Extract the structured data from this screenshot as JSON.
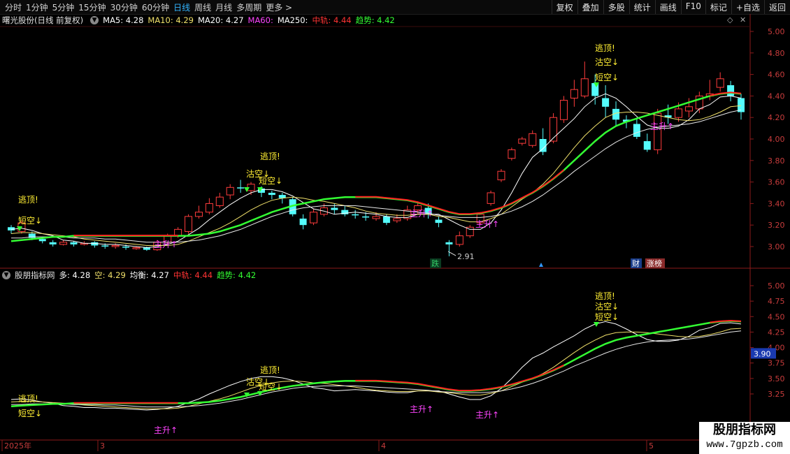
{
  "toolbar": {
    "periods": [
      "分时",
      "1分钟",
      "5分钟",
      "15分钟",
      "30分钟",
      "60分钟",
      "日线",
      "周线",
      "月线",
      "多周期",
      "更多 >"
    ],
    "active_period": "日线",
    "tools": [
      "复权",
      "叠加",
      "多股",
      "统计",
      "画线",
      "F10",
      "标记",
      "+自选",
      "返回"
    ]
  },
  "main_panel": {
    "title": "曙光股份(日线 前复权)",
    "legend": [
      {
        "label": "MA5: 4.28",
        "color": "#ffffff"
      },
      {
        "label": "MA10: 4.29",
        "color": "#f0e06a"
      },
      {
        "label": "MA20: 4.27",
        "color": "#ffffff"
      },
      {
        "label": "MA60:",
        "color": "#ff44ff"
      },
      {
        "label": "MA250:",
        "color": "#ffffff"
      },
      {
        "label": "中轨: 4.44",
        "color": "#ff3333"
      },
      {
        "label": "趋势: 4.42",
        "color": "#33ff33"
      }
    ],
    "y_ticks": [
      "5.00",
      "4.80",
      "4.60",
      "4.40",
      "4.20",
      "4.00",
      "3.80",
      "3.60",
      "3.40",
      "3.20",
      "3.00"
    ],
    "low_label": "2.91",
    "badges": [
      {
        "text": "跌",
        "color": "#33cc66",
        "bg": "#0b3b20"
      },
      {
        "text": "财",
        "color": "#ffffff",
        "bg": "#1a3d8a"
      },
      {
        "text": "涨榜",
        "color": "#ffffff",
        "bg": "#8a2a2a"
      }
    ],
    "annotations": [
      {
        "text": "逃顶!",
        "color": "#ffee33"
      },
      {
        "text": "短空↓",
        "color": "#ffee33"
      },
      {
        "text": "逃顶!",
        "color": "#ffee33"
      },
      {
        "text": "沽空↓",
        "color": "#ffee33"
      },
      {
        "text": "短空↓",
        "color": "#ffee33"
      },
      {
        "text": "逃顶!",
        "color": "#ffee33"
      },
      {
        "text": "沽空↓",
        "color": "#ffee33"
      },
      {
        "text": "短空↓",
        "color": "#ffee33"
      },
      {
        "text": "主升↑",
        "color": "#ff44ff"
      },
      {
        "text": "主升↑",
        "color": "#ff44ff"
      },
      {
        "text": "主升↑",
        "color": "#ff44ff"
      },
      {
        "text": "主升↑",
        "color": "#ff44ff"
      }
    ]
  },
  "sub_panel": {
    "title": "股朋指标网",
    "legend": [
      {
        "label": "多: 4.28",
        "color": "#ffffff"
      },
      {
        "label": "空: 4.29",
        "color": "#f0e06a"
      },
      {
        "label": "均衡: 4.27",
        "color": "#ffffff"
      },
      {
        "label": "中轨: 4.44",
        "color": "#ff3333"
      },
      {
        "label": "趋势: 4.42",
        "color": "#33ff33"
      }
    ],
    "y_ticks": [
      "5.00",
      "4.75",
      "4.50",
      "4.25",
      "4.00",
      "3.75",
      "3.50",
      "3.25"
    ],
    "cursor_value": "3.90",
    "annotations": [
      {
        "text": "逃顶!",
        "color": "#ffee33"
      },
      {
        "text": "短空↓",
        "color": "#ffee33"
      },
      {
        "text": "逃顶!",
        "color": "#ffee33"
      },
      {
        "text": "沽空↓",
        "color": "#ffee33"
      },
      {
        "text": "短空↓",
        "color": "#ffee33"
      },
      {
        "text": "逃顶!",
        "color": "#ffee33"
      },
      {
        "text": "沽空↓",
        "color": "#ffee33"
      },
      {
        "text": "短空↓",
        "color": "#ffee33"
      },
      {
        "text": "主升↑",
        "color": "#ff44ff"
      },
      {
        "text": "主升↑",
        "color": "#ff44ff"
      },
      {
        "text": "主升↑",
        "color": "#ff44ff"
      }
    ]
  },
  "x_axis": [
    "2025年",
    "3",
    "4",
    "5"
  ],
  "watermark": {
    "line1": "股朋指标网",
    "line2": "www.7gpzb.com"
  },
  "chart_data": {
    "type": "line",
    "title": "曙光股份(日线 前复权)",
    "ylim": [
      2.9,
      5.0
    ],
    "candles": [
      [
        3.18,
        3.15,
        3.2,
        3.12
      ],
      [
        3.14,
        3.22,
        3.24,
        3.12
      ],
      [
        3.12,
        3.08,
        3.14,
        3.06
      ],
      [
        3.07,
        3.05,
        3.09,
        3.03
      ],
      [
        3.04,
        3.02,
        3.06,
        3.0
      ],
      [
        3.02,
        3.04,
        3.06,
        3.01
      ],
      [
        3.04,
        3.02,
        3.05,
        3.0
      ],
      [
        3.02,
        3.03,
        3.05,
        3.01
      ],
      [
        3.04,
        3.01,
        3.05,
        2.99
      ],
      [
        3.01,
        3.0,
        3.03,
        2.98
      ],
      [
        3.0,
        3.01,
        3.03,
        2.98
      ],
      [
        3.0,
        2.99,
        3.02,
        2.97
      ],
      [
        2.98,
        2.99,
        3.0,
        2.97
      ],
      [
        2.99,
        2.97,
        3.0,
        2.96
      ],
      [
        2.97,
        3.04,
        3.06,
        2.96
      ],
      [
        3.04,
        3.1,
        3.12,
        3.02
      ],
      [
        3.1,
        3.16,
        3.18,
        3.08
      ],
      [
        3.14,
        3.28,
        3.3,
        3.12
      ],
      [
        3.28,
        3.32,
        3.38,
        3.26
      ],
      [
        3.32,
        3.4,
        3.45,
        3.3
      ],
      [
        3.38,
        3.46,
        3.5,
        3.36
      ],
      [
        3.48,
        3.55,
        3.58,
        3.44
      ],
      [
        3.55,
        3.54,
        3.62,
        3.5
      ],
      [
        3.52,
        3.58,
        3.6,
        3.48
      ],
      [
        3.54,
        3.5,
        3.56,
        3.46
      ],
      [
        3.5,
        3.48,
        3.52,
        3.44
      ],
      [
        3.48,
        3.45,
        3.5,
        3.4
      ],
      [
        3.44,
        3.3,
        3.46,
        3.28
      ],
      [
        3.26,
        3.2,
        3.3,
        3.16
      ],
      [
        3.22,
        3.32,
        3.35,
        3.2
      ],
      [
        3.3,
        3.36,
        3.4,
        3.28
      ],
      [
        3.36,
        3.34,
        3.4,
        3.3
      ],
      [
        3.34,
        3.3,
        3.38,
        3.28
      ],
      [
        3.3,
        3.29,
        3.34,
        3.26
      ],
      [
        3.28,
        3.27,
        3.32,
        3.24
      ],
      [
        3.26,
        3.28,
        3.32,
        3.24
      ],
      [
        3.28,
        3.22,
        3.3,
        3.2
      ],
      [
        3.24,
        3.26,
        3.3,
        3.22
      ],
      [
        3.26,
        3.34,
        3.38,
        3.24
      ],
      [
        3.34,
        3.38,
        3.42,
        3.3
      ],
      [
        3.36,
        3.3,
        3.4,
        3.26
      ],
      [
        3.25,
        3.22,
        3.28,
        3.18
      ],
      [
        3.04,
        3.02,
        3.06,
        2.91
      ],
      [
        3.02,
        3.1,
        3.14,
        3.0
      ],
      [
        3.1,
        3.18,
        3.2,
        3.08
      ],
      [
        3.22,
        3.3,
        3.32,
        3.2
      ],
      [
        3.4,
        3.5,
        3.52,
        3.38
      ],
      [
        3.62,
        3.7,
        3.72,
        3.6
      ],
      [
        3.82,
        3.9,
        3.92,
        3.8
      ],
      [
        3.96,
        4.0,
        4.02,
        3.94
      ],
      [
        3.94,
        4.05,
        4.08,
        3.92
      ],
      [
        4.0,
        3.88,
        4.1,
        3.85
      ],
      [
        3.98,
        4.2,
        4.24,
        3.96
      ],
      [
        4.18,
        4.36,
        4.4,
        4.15
      ],
      [
        4.38,
        4.46,
        4.55,
        4.3
      ],
      [
        4.4,
        4.56,
        4.72,
        4.38
      ],
      [
        4.52,
        4.4,
        4.6,
        4.32
      ],
      [
        4.38,
        4.3,
        4.5,
        4.2
      ],
      [
        4.28,
        4.18,
        4.35,
        4.12
      ],
      [
        4.18,
        4.16,
        4.22,
        4.1
      ],
      [
        4.14,
        4.02,
        4.2,
        4.0
      ],
      [
        3.98,
        3.9,
        4.05,
        3.88
      ],
      [
        3.9,
        4.24,
        4.28,
        3.86
      ],
      [
        4.22,
        4.2,
        4.32,
        4.14
      ],
      [
        4.2,
        4.28,
        4.34,
        4.16
      ],
      [
        4.26,
        4.3,
        4.38,
        4.2
      ],
      [
        4.28,
        4.4,
        4.44,
        4.24
      ],
      [
        4.4,
        4.42,
        4.55,
        4.36
      ],
      [
        4.48,
        4.56,
        4.62,
        4.44
      ],
      [
        4.5,
        4.4,
        4.54,
        4.35
      ],
      [
        4.38,
        4.25,
        4.42,
        4.18
      ]
    ],
    "series": [
      {
        "name": "MA5",
        "values": [
          3.16,
          3.17,
          3.15,
          3.12,
          3.1,
          3.06,
          3.05,
          3.03,
          3.03,
          3.02,
          3.02,
          3.01,
          3.0,
          2.99,
          3.0,
          3.02,
          3.05,
          3.11,
          3.17,
          3.25,
          3.32,
          3.39,
          3.45,
          3.5,
          3.53,
          3.53,
          3.51,
          3.47,
          3.41,
          3.35,
          3.33,
          3.3,
          3.31,
          3.32,
          3.31,
          3.3,
          3.28,
          3.27,
          3.27,
          3.3,
          3.3,
          3.3,
          3.25,
          3.2,
          3.16,
          3.16,
          3.22,
          3.34,
          3.5,
          3.68,
          3.83,
          3.91,
          4.01,
          4.1,
          4.19,
          4.3,
          4.38,
          4.42,
          4.38,
          4.3,
          4.21,
          4.13,
          4.1,
          4.1,
          4.12,
          4.18,
          4.28,
          4.32,
          4.39,
          4.4,
          4.38
        ]
      },
      {
        "name": "MA10",
        "values": [
          3.12,
          3.13,
          3.13,
          3.12,
          3.11,
          3.1,
          3.09,
          3.07,
          3.06,
          3.05,
          3.04,
          3.03,
          3.02,
          3.01,
          3.01,
          3.01,
          3.02,
          3.05,
          3.09,
          3.13,
          3.17,
          3.22,
          3.28,
          3.34,
          3.39,
          3.43,
          3.45,
          3.46,
          3.45,
          3.43,
          3.42,
          3.4,
          3.38,
          3.36,
          3.33,
          3.31,
          3.3,
          3.29,
          3.29,
          3.3,
          3.3,
          3.28,
          3.27,
          3.25,
          3.23,
          3.23,
          3.26,
          3.3,
          3.37,
          3.44,
          3.5,
          3.58,
          3.68,
          3.8,
          3.92,
          4.03,
          4.12,
          4.2,
          4.24,
          4.25,
          4.25,
          4.24,
          4.22,
          4.2,
          4.18,
          4.17,
          4.18,
          4.21,
          4.25,
          4.3,
          4.31
        ]
      },
      {
        "name": "MA20",
        "values": [
          3.08,
          3.08,
          3.09,
          3.09,
          3.09,
          3.09,
          3.08,
          3.08,
          3.08,
          3.07,
          3.07,
          3.06,
          3.05,
          3.04,
          3.04,
          3.04,
          3.04,
          3.05,
          3.06,
          3.08,
          3.1,
          3.13,
          3.16,
          3.2,
          3.24,
          3.28,
          3.31,
          3.34,
          3.36,
          3.37,
          3.38,
          3.38,
          3.38,
          3.38,
          3.37,
          3.36,
          3.35,
          3.34,
          3.33,
          3.32,
          3.31,
          3.29,
          3.28,
          3.27,
          3.27,
          3.27,
          3.28,
          3.3,
          3.33,
          3.37,
          3.42,
          3.48,
          3.55,
          3.62,
          3.7,
          3.77,
          3.84,
          3.91,
          3.97,
          4.02,
          4.06,
          4.09,
          4.11,
          4.12,
          4.13,
          4.14,
          4.16,
          4.19,
          4.22,
          4.25,
          4.27
        ]
      },
      {
        "name": "趋势",
        "values": [
          3.05,
          3.06,
          3.07,
          3.08,
          3.09,
          3.09,
          3.1,
          3.1,
          3.1,
          3.1,
          3.1,
          3.1,
          3.1,
          3.1,
          3.1,
          3.1,
          3.1,
          3.1,
          3.11,
          3.12,
          3.14,
          3.17,
          3.2,
          3.24,
          3.28,
          3.32,
          3.35,
          3.38,
          3.4,
          3.42,
          3.44,
          3.45,
          3.46,
          3.46,
          3.46,
          3.46,
          3.45,
          3.44,
          3.43,
          3.41,
          3.38,
          3.35,
          3.32,
          3.3,
          3.3,
          3.31,
          3.33,
          3.36,
          3.4,
          3.45,
          3.5,
          3.56,
          3.63,
          3.71,
          3.8,
          3.89,
          3.98,
          4.06,
          4.12,
          4.16,
          4.19,
          4.22,
          4.25,
          4.28,
          4.31,
          4.34,
          4.37,
          4.4,
          4.42,
          4.43,
          4.42
        ]
      }
    ]
  }
}
